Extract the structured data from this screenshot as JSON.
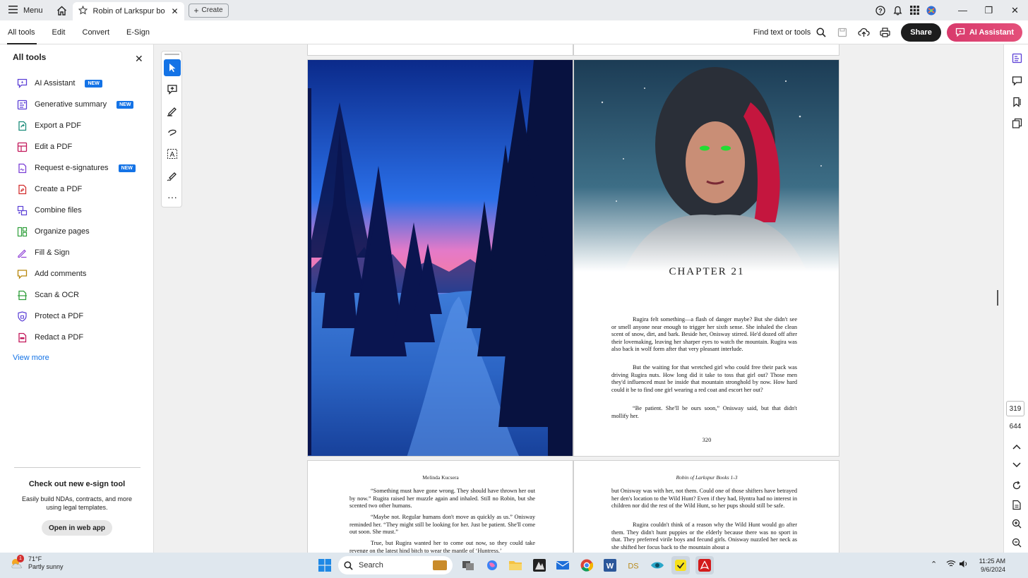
{
  "titlebar": {
    "menu_label": "Menu",
    "tab_title": "Robin of Larkspur books ...",
    "create_label": "Create"
  },
  "toolbar": {
    "tabs": [
      "All tools",
      "Edit",
      "Convert",
      "E-Sign"
    ],
    "find_label": "Find text or tools",
    "share_label": "Share",
    "ai_label": "AI Assistant"
  },
  "sidebar": {
    "title": "All tools",
    "items": [
      {
        "label": "AI Assistant",
        "badge": "NEW",
        "color": "#5b3fd6"
      },
      {
        "label": "Generative summary",
        "badge": "NEW",
        "color": "#5b3fd6"
      },
      {
        "label": "Export a PDF",
        "badge": "",
        "color": "#1b8c7a"
      },
      {
        "label": "Edit a PDF",
        "badge": "",
        "color": "#c2185b"
      },
      {
        "label": "Request e-signatures",
        "badge": "NEW",
        "color": "#7b3fd6"
      },
      {
        "label": "Create a PDF",
        "badge": "",
        "color": "#d32f2f"
      },
      {
        "label": "Combine files",
        "badge": "",
        "color": "#5b3fd6"
      },
      {
        "label": "Organize pages",
        "badge": "",
        "color": "#2e9e3a"
      },
      {
        "label": "Fill & Sign",
        "badge": "",
        "color": "#8e3fd6"
      },
      {
        "label": "Add comments",
        "badge": "",
        "color": "#b8860b"
      },
      {
        "label": "Scan & OCR",
        "badge": "",
        "color": "#2e9e3a"
      },
      {
        "label": "Protect a PDF",
        "badge": "",
        "color": "#5b3fd6"
      },
      {
        "label": "Redact a PDF",
        "badge": "",
        "color": "#c2185b"
      }
    ],
    "view_more": "View more",
    "promo_title": "Check out new e-sign tool",
    "promo_body": "Easily build NDAs, contracts, and more using legal templates.",
    "promo_button": "Open in web app"
  },
  "document": {
    "chapter_title": "CHAPTER 21",
    "chapter_paragraphs": [
      "Rugira felt something—a flash of danger maybe? But she didn't see or smell anyone near enough to trigger her sixth sense. She inhaled the clean scent of snow, dirt, and bark. Beside her, Onisway stirred. He'd dozed off after their lovemaking, leaving her sharper eyes to watch the mountain. Rugira was also back in wolf form after that very pleasant interlude.",
      "But the waiting for that wretched girl who could free their pack was driving Rugira nuts. How long did it take to toss that girl out? Those men they'd influenced must be inside that mountain stronghold by now. How hard could it be to find one girl wearing a red coat and escort her out?",
      "“Be patient. She'll be ours soon,” Onisway said, but that didn't mollify her."
    ],
    "right_page_number": "320",
    "left_running_head": "Melinda Kucsera",
    "right_running_head": "Robin of Larkspur Books 1-3",
    "bottom_left_paragraphs": [
      "“Something must have gone wrong. They should have thrown her out by now.” Rugira raised her muzzle again and inhaled. Still no Robin, but she scented two other humans.",
      "“Maybe not. Regular humans don't move as quickly as us.” Onisway reminded her. “They might still be looking for her. Just be patient. She'll come out soon. She must.”",
      "True, but Rugira wanted her to come out now, so they could take revenge on the latest hind bitch to wear the mantle of ‘Huntress.’"
    ],
    "bottom_right_paragraphs": [
      "but Onisway was with her, not them. Could one of those shifters have betrayed her den's location to the Wild Hunt? Even if they had, Hyntra had no interest in children nor did the rest of the Wild Hunt, so her pups should still be safe.",
      "Rugira couldn't think of a reason why the Wild Hunt would go after them. They didn't hunt puppies or the elderly because there was no sport in that. They preferred virile boys and fecund girls. Onisway nuzzled her neck as she shifted her focus back to the mountain about a"
    ]
  },
  "navigation": {
    "current_page": "319",
    "total_pages": "644"
  },
  "taskbar": {
    "temperature": "71°F",
    "weather": "Partly sunny",
    "weather_badge": "1",
    "search_placeholder": "Search",
    "time": "11:25 AM",
    "date": "9/6/2024"
  }
}
